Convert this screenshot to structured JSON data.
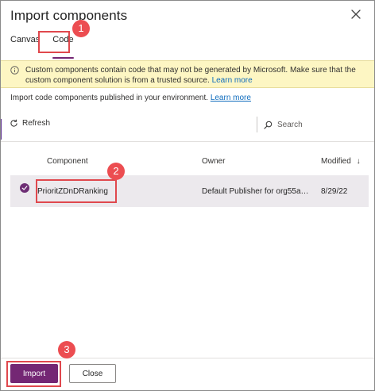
{
  "dialog": {
    "title": "Import components"
  },
  "tabs": [
    {
      "label": "Canvas",
      "active": false
    },
    {
      "label": "Code",
      "active": true
    }
  ],
  "warning": {
    "text": "Custom components contain code that may not be generated by Microsoft. Make sure that the custom component solution is from a trusted source.",
    "link": "Learn more"
  },
  "description": {
    "text": "Import code components published in your environment.",
    "link": "Learn more"
  },
  "toolbar": {
    "refresh_label": "Refresh",
    "search_placeholder": "Search"
  },
  "table": {
    "columns": [
      "Component",
      "Owner",
      "Modified"
    ],
    "sort_indicator": "↓",
    "rows": [
      {
        "component": "PrioritZDnDRanking",
        "owner": "Default Publisher for org55ab3...",
        "modified": "8/29/22",
        "selected": true
      }
    ]
  },
  "callouts": [
    "1",
    "2",
    "3"
  ],
  "footer": {
    "import_label": "Import",
    "close_label": "Close"
  },
  "colors": {
    "accent": "#742774",
    "warning_bg": "#fdf6c3",
    "selected_row": "#ece9ed",
    "callout": "#ec4d51"
  },
  "icons": [
    "close-icon",
    "info-icon",
    "refresh-icon",
    "search-icon",
    "checkmark-icon",
    "sort-down-icon"
  ]
}
